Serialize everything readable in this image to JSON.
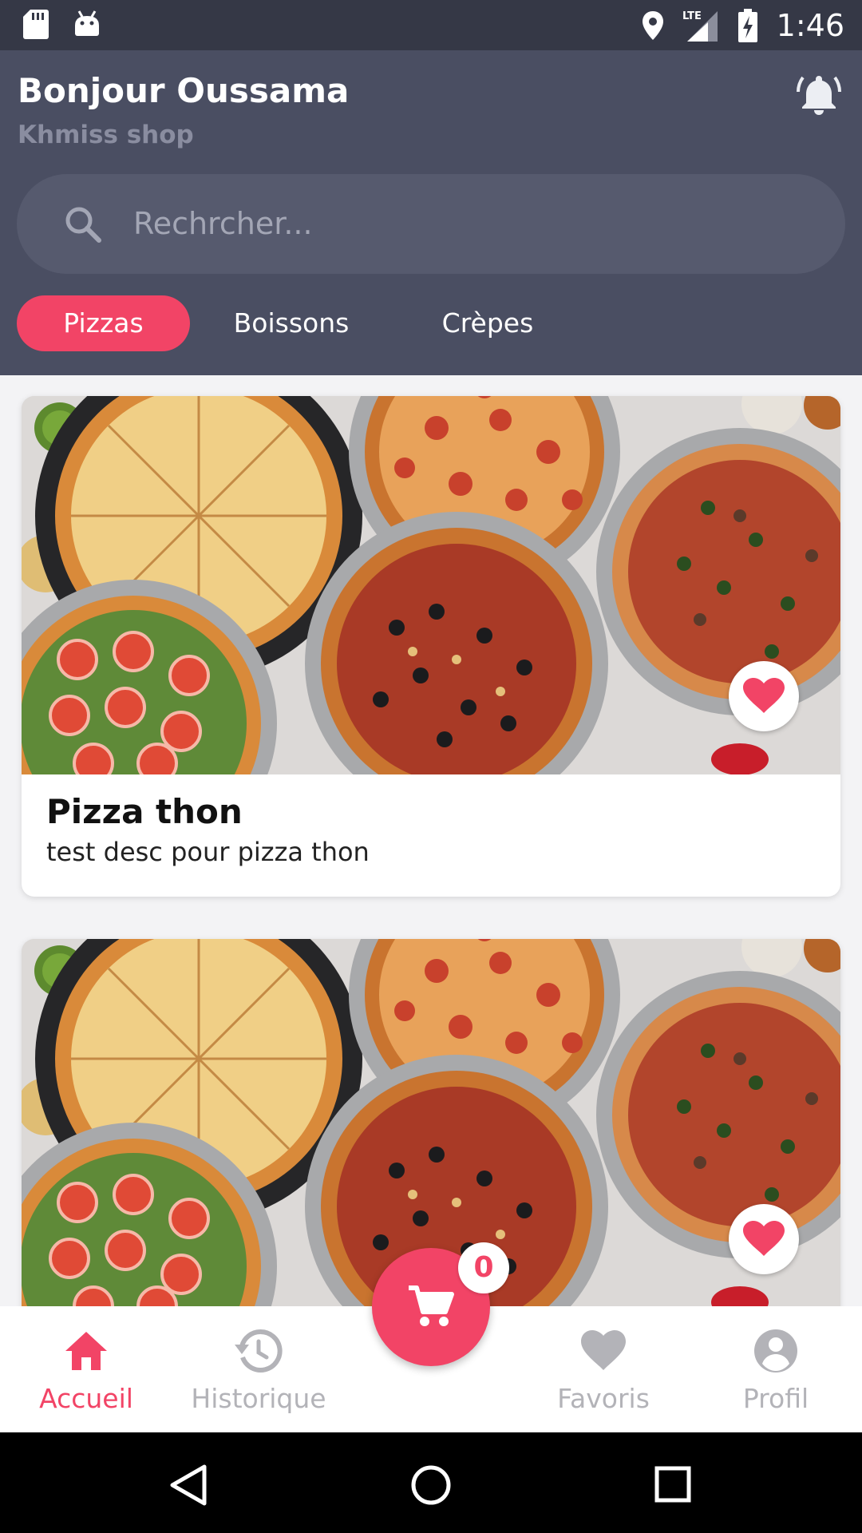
{
  "status_bar": {
    "time": "1:46",
    "network": "LTE",
    "icons": [
      "sd-card-icon",
      "android-icon",
      "location-icon",
      "signal-icon",
      "battery-charging-icon"
    ]
  },
  "header": {
    "greeting": "Bonjour Oussama",
    "shop_name": "Khmiss shop",
    "bell_icon": "bell-ringing-icon"
  },
  "search": {
    "placeholder": "Rechrcher...",
    "value": ""
  },
  "categories": [
    {
      "label": "Pizzas",
      "active": true
    },
    {
      "label": "Boissons",
      "active": false
    },
    {
      "label": "Crèpes",
      "active": false
    }
  ],
  "products": [
    {
      "title": "Pizza thon",
      "description": "test desc pour pizza thon",
      "favorite": true
    },
    {
      "title": "",
      "description": "",
      "favorite": true
    }
  ],
  "cart": {
    "count": "0",
    "icon": "cart-icon"
  },
  "bottom_nav": [
    {
      "label": "Accueil",
      "icon": "home-icon",
      "active": true
    },
    {
      "label": "Historique",
      "icon": "history-icon",
      "active": false
    },
    {
      "label": "Favoris",
      "icon": "heart-icon",
      "active": false
    },
    {
      "label": "Profil",
      "icon": "account-circle-icon",
      "active": false
    }
  ],
  "system_nav": [
    "back-icon",
    "home-circle-icon",
    "recents-icon"
  ],
  "colors": {
    "accent": "#f24466",
    "header_bg": "#4a4e62",
    "status_bg": "#353846",
    "muted": "#b3b3b8"
  }
}
